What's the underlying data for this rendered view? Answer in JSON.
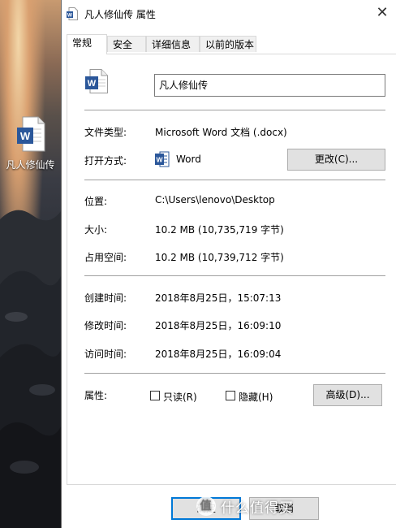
{
  "desktop": {
    "icon_label": "凡人修仙传"
  },
  "window": {
    "title": "凡人修仙传 属性",
    "close_glyph": "✕"
  },
  "tabs": [
    {
      "label": "常规"
    },
    {
      "label": "安全"
    },
    {
      "label": "详细信息"
    },
    {
      "label": "以前的版本"
    }
  ],
  "general": {
    "filename": "凡人修仙传",
    "type_label": "文件类型:",
    "type_value": "Microsoft Word 文档 (.docx)",
    "opens_with_label": "打开方式:",
    "opens_with_value": "Word",
    "change_button": "更改(C)...",
    "location_label": "位置:",
    "location_value": "C:\\Users\\lenovo\\Desktop",
    "size_label": "大小:",
    "size_value": "10.2 MB (10,735,719 字节)",
    "size_on_disk_label": "占用空间:",
    "size_on_disk_value": "10.2 MB (10,739,712 字节)",
    "created_label": "创建时间:",
    "created_value": "2018年8月25日，15:07:13",
    "modified_label": "修改时间:",
    "modified_value": "2018年8月25日，16:09:10",
    "accessed_label": "访问时间:",
    "accessed_value": "2018年8月25日，16:09:04",
    "attributes_label": "属性:",
    "readonly_label": "只读(R)",
    "hidden_label": "隐藏(H)",
    "advanced_button": "高级(D)..."
  },
  "footer": {
    "ok_button": "确定",
    "cancel_button": "取消"
  },
  "watermark": {
    "glyph": "值",
    "text": "什么值得买"
  },
  "colors": {
    "word_blue": "#2b579a",
    "focus_blue": "#0078d7"
  }
}
